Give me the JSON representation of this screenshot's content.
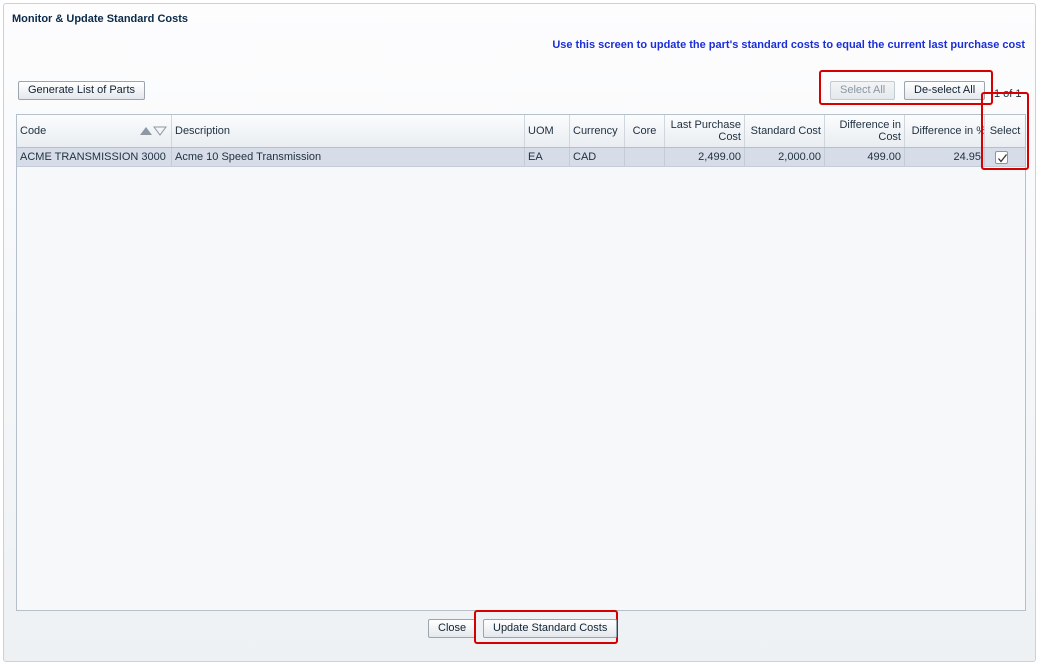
{
  "window": {
    "title": "Monitor & Update Standard Costs"
  },
  "instruction": "Use this screen to update the part's standard costs to equal the current last purchase cost",
  "toolbar": {
    "generate_label": "Generate List of Parts",
    "select_all_label": "Select All",
    "deselect_all_label": "De-select All",
    "pager": "1 of 1"
  },
  "table": {
    "headers": {
      "code": "Code",
      "description": "Description",
      "uom": "UOM",
      "currency": "Currency",
      "core": "Core",
      "last_purchase_cost": "Last Purchase Cost",
      "standard_cost": "Standard Cost",
      "difference_cost": "Difference in Cost",
      "difference_pct": "Difference in %",
      "select": "Select"
    },
    "rows": [
      {
        "code": "ACME TRANSMISSION 3000",
        "description": "Acme 10 Speed Transmission",
        "uom": "EA",
        "currency": "CAD",
        "core": "",
        "last_purchase_cost": "2,499.00",
        "standard_cost": "2,000.00",
        "difference_cost": "499.00",
        "difference_pct": "24.95",
        "selected": true
      }
    ]
  },
  "footer": {
    "close_label": "Close",
    "update_label": "Update Standard Costs"
  },
  "colors": {
    "instruction": "#1b2fd6",
    "highlight": "#d70000",
    "row_selected": "#d6dde8"
  }
}
